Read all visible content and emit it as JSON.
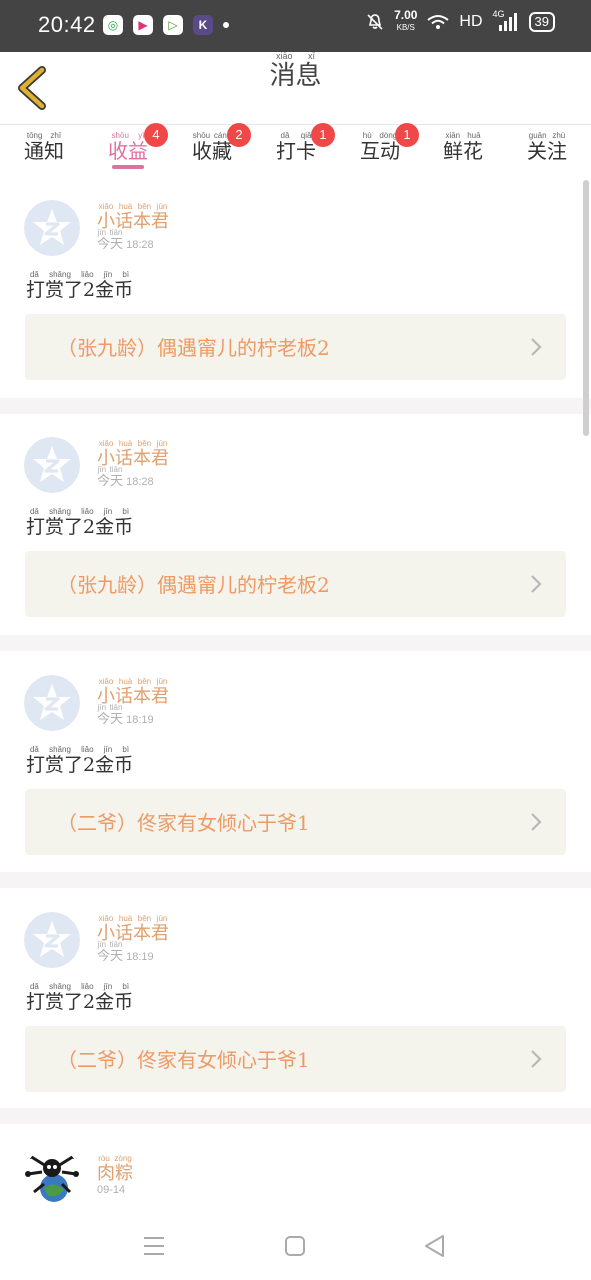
{
  "status_bar": {
    "time": "20:42",
    "speed_value": "7.00",
    "speed_unit": "KB/S",
    "network": "HD",
    "signal_type": "4G",
    "battery": "39"
  },
  "header": {
    "title": "消息",
    "title_pinyin": "xiāo xī"
  },
  "tabs": [
    {
      "label": "通知",
      "pinyin": "tōng zhī",
      "badge": "",
      "active": false
    },
    {
      "label": "收益",
      "pinyin": "shōu yì",
      "badge": "4",
      "active": true
    },
    {
      "label": "收藏",
      "pinyin": "shōu cáng",
      "badge": "2",
      "active": false
    },
    {
      "label": "打卡",
      "pinyin": "dǎ qiǎ",
      "badge": "1",
      "active": false
    },
    {
      "label": "互动",
      "pinyin": "hù dòng",
      "badge": "1",
      "active": false
    },
    {
      "label": "鲜花",
      "pinyin": "xiān huā",
      "badge": "",
      "active": false
    },
    {
      "label": "关注",
      "pinyin": "guān zhù",
      "badge": "",
      "active": false
    }
  ],
  "messages": [
    {
      "user": "小话本君",
      "user_pinyin": "xiǎo huà běn jūn",
      "day": "今天",
      "day_pinyin": "jīn tiān",
      "time": "18:28",
      "action": "打赏了2金币",
      "action_pinyin": "dǎ shǎng liǎo jīn bì",
      "item": "（张九龄）偶遇甯儿的柠老板2"
    },
    {
      "user": "小话本君",
      "user_pinyin": "xiǎo huà běn jūn",
      "day": "今天",
      "day_pinyin": "jīn tiān",
      "time": "18:28",
      "action": "打赏了2金币",
      "action_pinyin": "dǎ shǎng liǎo jīn bì",
      "item": "（张九龄）偶遇甯儿的柠老板2"
    },
    {
      "user": "小话本君",
      "user_pinyin": "xiǎo huà běn jūn",
      "day": "今天",
      "day_pinyin": "jīn tiān",
      "time": "18:19",
      "action": "打赏了2金币",
      "action_pinyin": "dǎ shǎng liǎo jīn bì",
      "item": "（二爷）佟家有女倾心于爷1"
    },
    {
      "user": "小话本君",
      "user_pinyin": "xiǎo huà běn jūn",
      "day": "今天",
      "day_pinyin": "jīn tiān",
      "time": "18:19",
      "action": "打赏了2金币",
      "action_pinyin": "dǎ shǎng liǎo jīn bì",
      "item": "（二爷）佟家有女倾心于爷1"
    },
    {
      "user": "肉粽",
      "user_pinyin": "ròu zòng",
      "day": "",
      "day_pinyin": "",
      "time": "09-14",
      "action": "",
      "action_pinyin": "",
      "item": ""
    }
  ],
  "colors": {
    "accent_pink": "#e0709f",
    "badge_red": "#f04848",
    "name_orange": "#e0a070",
    "item_text": "#ee9a66",
    "back_arrow": "#d4a020"
  },
  "icons": {
    "back": "chevron-left-icon",
    "item_arrow": "chevron-right-icon",
    "nav_menu": "menu-icon",
    "nav_home": "home-square-icon",
    "nav_back": "back-triangle-icon"
  }
}
